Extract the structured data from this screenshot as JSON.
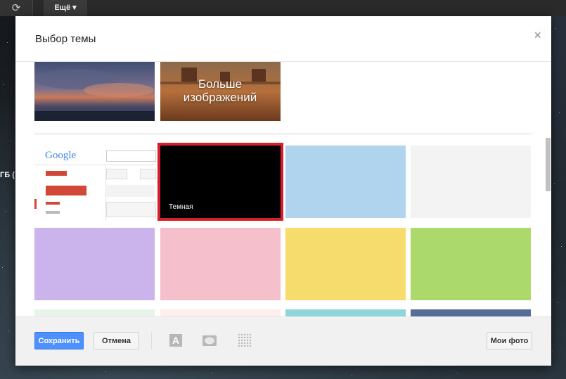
{
  "background": {
    "topbar": {
      "refresh_icon": "⟳",
      "more_label": "Ещё ▾"
    },
    "side_text": "ГБ ("
  },
  "dialog": {
    "title": "Выбор темы",
    "close_glyph": "×",
    "images": {
      "more_images_label": "Больше изображений"
    },
    "themes": [
      {
        "id": "classic",
        "label": "",
        "color": "#ffffff",
        "selected": false
      },
      {
        "id": "dark",
        "label": "Темная",
        "color": "#000000",
        "selected": true
      },
      {
        "id": "light-blue",
        "label": "",
        "color": "#b1d4ee",
        "selected": false
      },
      {
        "id": "light-gray",
        "label": "",
        "color": "#f3f3f3",
        "selected": false
      },
      {
        "id": "lavender",
        "label": "",
        "color": "#cbb4eb",
        "selected": false
      },
      {
        "id": "pink",
        "label": "",
        "color": "#f5bfcc",
        "selected": false
      },
      {
        "id": "yellow",
        "label": "",
        "color": "#f6dc6c",
        "selected": false
      },
      {
        "id": "green",
        "label": "",
        "color": "#acd96b",
        "selected": false
      },
      {
        "id": "mint",
        "label": "",
        "color": "#e6f4ea",
        "selected": false
      },
      {
        "id": "cherry-blossom",
        "label": "",
        "color": "#fcefee",
        "selected": false
      },
      {
        "id": "teal",
        "label": "",
        "color": "#8fd5d9",
        "selected": false
      },
      {
        "id": "slate-blue",
        "label": "",
        "color": "#566e95",
        "selected": false
      }
    ],
    "selection_color": "#d5202b",
    "classic_preview": {
      "brand": "Google"
    },
    "footer": {
      "save_label": "Сохранить",
      "cancel_label": "Отмена",
      "my_photos_label": "Мои фото",
      "tools": [
        "text-color-icon",
        "vignette-icon",
        "blur-icon"
      ]
    }
  }
}
